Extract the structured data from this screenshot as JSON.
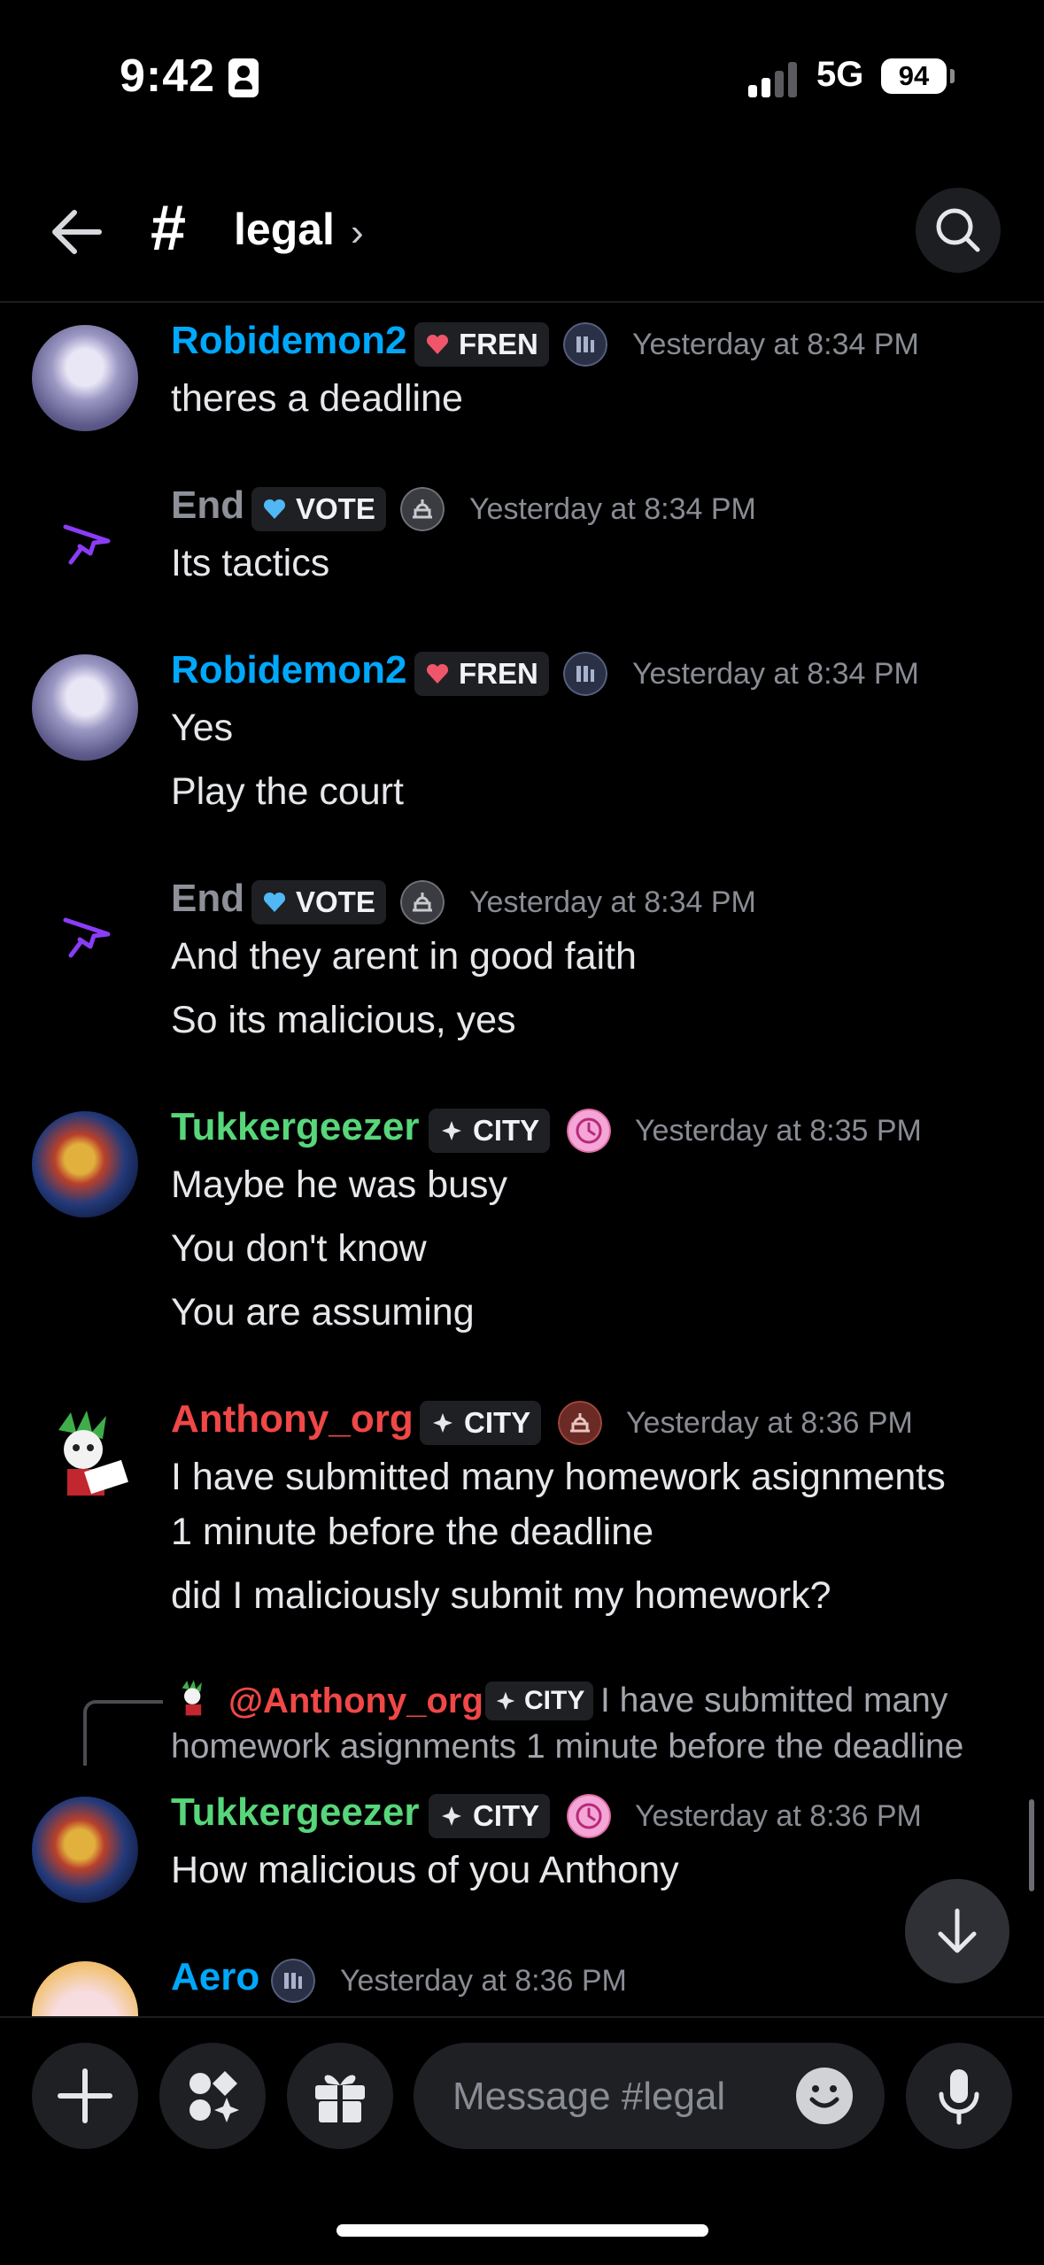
{
  "status_bar": {
    "time": "9:42",
    "network": "5G",
    "battery": "94"
  },
  "header": {
    "channel_hash": "#",
    "channel_name": "legal",
    "chevron": "›"
  },
  "messages": [
    {
      "author": "Robidemon2",
      "author_color": "#00a8fc",
      "tag": "FREN",
      "timestamp": "Yesterday at 8:34 PM",
      "lines": [
        "theres a deadline"
      ]
    },
    {
      "author": "End",
      "author_color": "#8e9099",
      "tag": "VOTE",
      "timestamp": "Yesterday at 8:34 PM",
      "lines": [
        "Its tactics"
      ]
    },
    {
      "author": "Robidemon2",
      "author_color": "#00a8fc",
      "tag": "FREN",
      "timestamp": "Yesterday at 8:34 PM",
      "lines": [
        "Yes",
        "Play the court"
      ]
    },
    {
      "author": "End",
      "author_color": "#8e9099",
      "tag": "VOTE",
      "timestamp": "Yesterday at 8:34 PM",
      "lines": [
        "And they arent in good faith",
        "So its malicious, yes"
      ]
    },
    {
      "author": "Tukkergeezer",
      "author_color": "#57d67a",
      "tag": "CITY",
      "timestamp": "Yesterday at 8:35 PM",
      "lines": [
        "Maybe he was busy",
        "You don't know",
        "You are assuming"
      ]
    },
    {
      "author": "Anthony_org",
      "author_color": "#f04747",
      "tag": "CITY",
      "timestamp": "Yesterday at 8:36 PM",
      "lines": [
        "I have submitted many homework asignments",
        "1 minute before the deadline",
        "did I maliciously submit my homework?"
      ]
    },
    {
      "author": "Tukkergeezer",
      "author_color": "#57d67a",
      "tag": "CITY",
      "timestamp": "Yesterday at 8:36 PM",
      "lines": [
        "How malicious of you Anthony"
      ],
      "reply": {
        "mention": "@Anthony_org",
        "tag": "CITY",
        "text_line1": "I have submitted many",
        "text_line2": "homework asignments 1 minute before the deadline"
      }
    },
    {
      "author": "Aero",
      "author_color": "#00a8fc",
      "timestamp": "Yesterday at 8:36 PM",
      "lines": []
    }
  ],
  "input": {
    "placeholder": "Message #legal"
  },
  "icons": [
    "back-arrow-icon",
    "hash-icon",
    "search-icon",
    "heart-icon",
    "columns-icon",
    "capitol-icon",
    "sparkle-icon",
    "clock-icon",
    "arrow-down-icon",
    "plus-icon",
    "apps-icon",
    "gift-icon",
    "emoji-icon",
    "microphone-icon"
  ]
}
